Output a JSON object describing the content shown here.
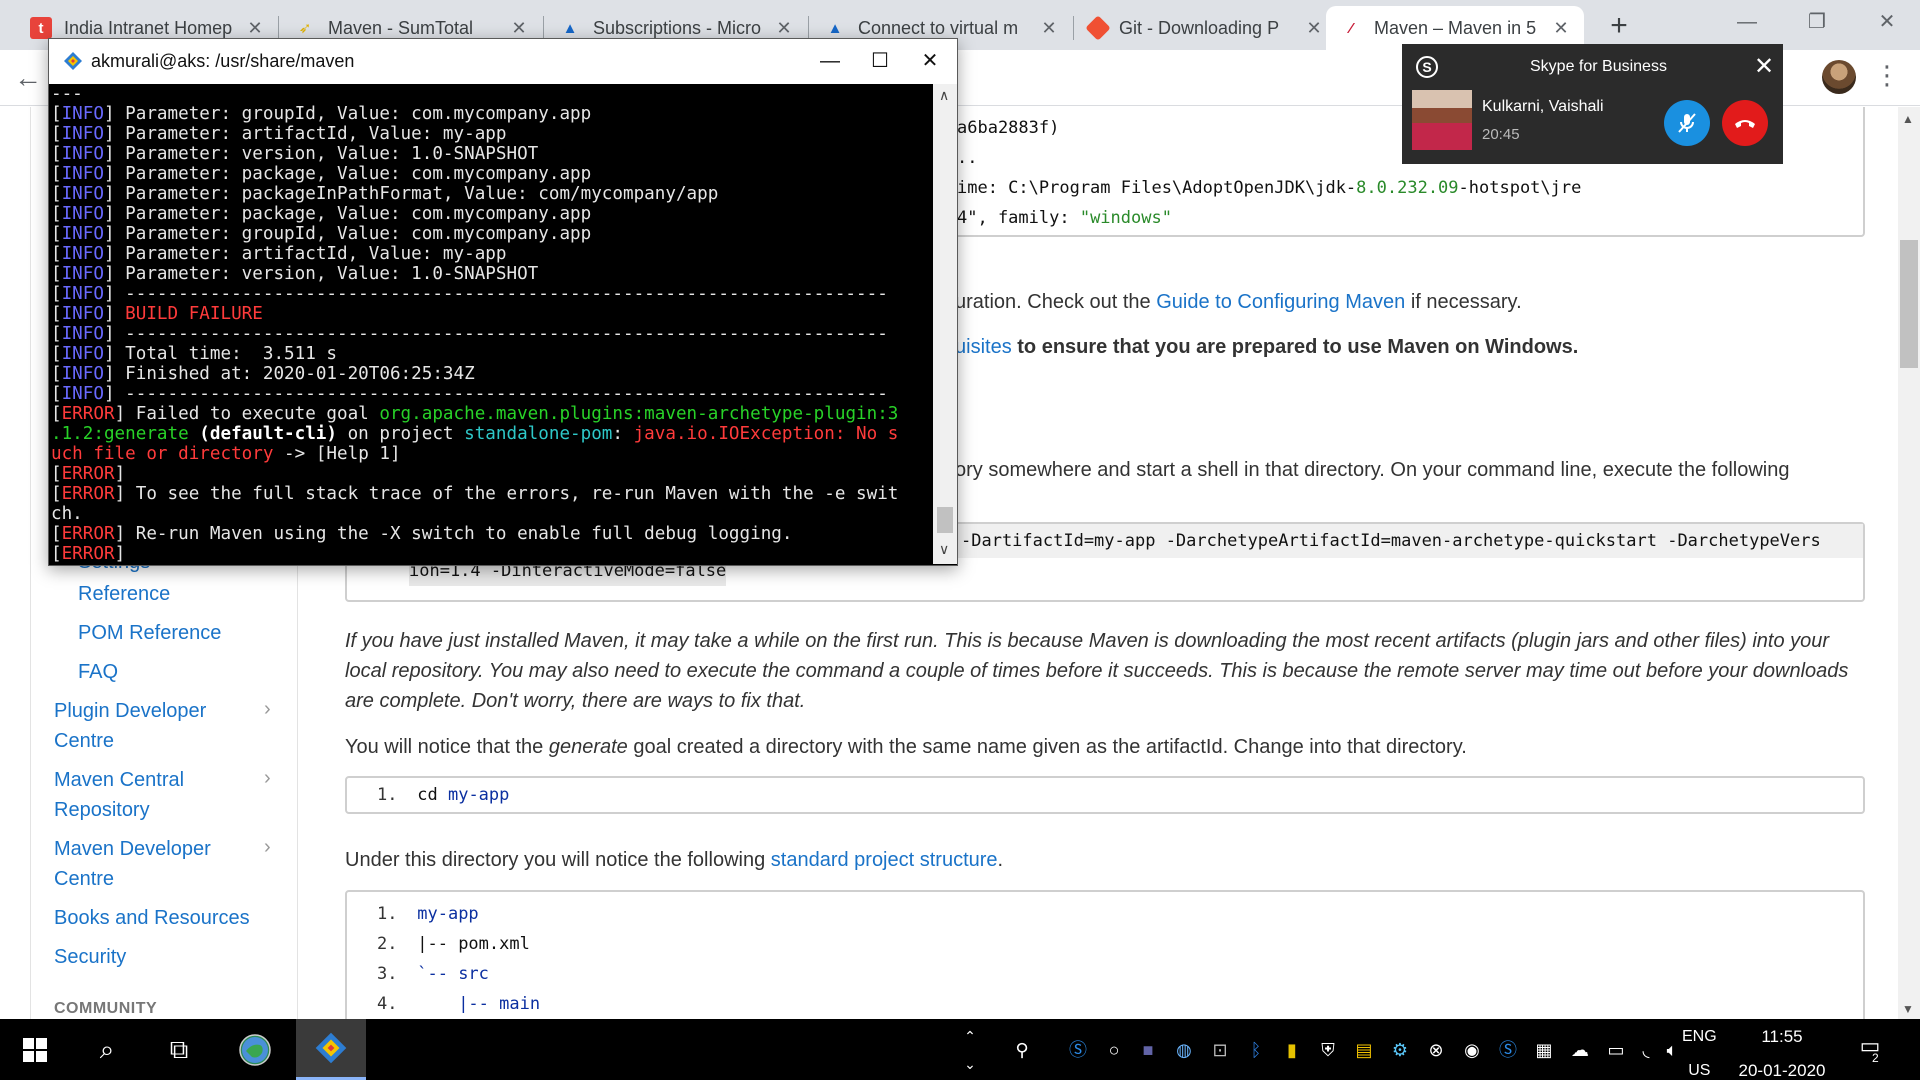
{
  "browser": {
    "tabs": [
      {
        "label": "India Intranet Homep",
        "icon": "t"
      },
      {
        "label": "Maven - SumTotal",
        "icon": "sumtotal-icon"
      },
      {
        "label": "Subscriptions - Micro",
        "icon": "azure-icon"
      },
      {
        "label": "Connect to virtual m",
        "icon": "azure-icon"
      },
      {
        "label": "Git - Downloading P",
        "icon": "git-icon"
      },
      {
        "label": "Maven – Maven in 5",
        "icon": "maven-feather-icon"
      }
    ],
    "new_tab": "+"
  },
  "terminal": {
    "title": "akmurali@aks: /usr/share/maven",
    "lines": [
      [
        {
          "t": "---",
          "c": ""
        }
      ],
      [
        {
          "t": "[",
          "c": ""
        },
        {
          "t": "INFO",
          "c": "t-info"
        },
        {
          "t": "] Parameter: groupId, Value: com.mycompany.app",
          "c": ""
        }
      ],
      [
        {
          "t": "[",
          "c": ""
        },
        {
          "t": "INFO",
          "c": "t-info"
        },
        {
          "t": "] Parameter: artifactId, Value: my-app",
          "c": ""
        }
      ],
      [
        {
          "t": "[",
          "c": ""
        },
        {
          "t": "INFO",
          "c": "t-info"
        },
        {
          "t": "] Parameter: version, Value: 1.0-SNAPSHOT",
          "c": ""
        }
      ],
      [
        {
          "t": "[",
          "c": ""
        },
        {
          "t": "INFO",
          "c": "t-info"
        },
        {
          "t": "] Parameter: package, Value: com.mycompany.app",
          "c": ""
        }
      ],
      [
        {
          "t": "[",
          "c": ""
        },
        {
          "t": "INFO",
          "c": "t-info"
        },
        {
          "t": "] Parameter: packageInPathFormat, Value: com/mycompany/app",
          "c": ""
        }
      ],
      [
        {
          "t": "[",
          "c": ""
        },
        {
          "t": "INFO",
          "c": "t-info"
        },
        {
          "t": "] Parameter: package, Value: com.mycompany.app",
          "c": ""
        }
      ],
      [
        {
          "t": "[",
          "c": ""
        },
        {
          "t": "INFO",
          "c": "t-info"
        },
        {
          "t": "] Parameter: groupId, Value: com.mycompany.app",
          "c": ""
        }
      ],
      [
        {
          "t": "[",
          "c": ""
        },
        {
          "t": "INFO",
          "c": "t-info"
        },
        {
          "t": "] Parameter: artifactId, Value: my-app",
          "c": ""
        }
      ],
      [
        {
          "t": "[",
          "c": ""
        },
        {
          "t": "INFO",
          "c": "t-info"
        },
        {
          "t": "] Parameter: version, Value: 1.0-SNAPSHOT",
          "c": ""
        }
      ],
      [
        {
          "t": "[",
          "c": ""
        },
        {
          "t": "INFO",
          "c": "t-info"
        },
        {
          "t": "] ------------------------------------------------------------------------",
          "c": ""
        }
      ],
      [
        {
          "t": "[",
          "c": ""
        },
        {
          "t": "INFO",
          "c": "t-info"
        },
        {
          "t": "] ",
          "c": ""
        },
        {
          "t": "BUILD FAILURE",
          "c": "t-red"
        }
      ],
      [
        {
          "t": "[",
          "c": ""
        },
        {
          "t": "INFO",
          "c": "t-info"
        },
        {
          "t": "] ------------------------------------------------------------------------",
          "c": ""
        }
      ],
      [
        {
          "t": "[",
          "c": ""
        },
        {
          "t": "INFO",
          "c": "t-info"
        },
        {
          "t": "] Total time:  3.511 s",
          "c": ""
        }
      ],
      [
        {
          "t": "[",
          "c": ""
        },
        {
          "t": "INFO",
          "c": "t-info"
        },
        {
          "t": "] Finished at: 2020-01-20T06:25:34Z",
          "c": ""
        }
      ],
      [
        {
          "t": "[",
          "c": ""
        },
        {
          "t": "INFO",
          "c": "t-info"
        },
        {
          "t": "] ------------------------------------------------------------------------",
          "c": ""
        }
      ],
      [
        {
          "t": "[",
          "c": ""
        },
        {
          "t": "ERROR",
          "c": "t-err"
        },
        {
          "t": "] Failed to execute goal ",
          "c": ""
        },
        {
          "t": "org.apache.maven.plugins:maven-archetype-plugin:3",
          "c": "t-green"
        }
      ],
      [
        {
          "t": ".1.2:generate",
          "c": "t-green"
        },
        {
          "t": " (default-cli)",
          "c": "t-white-b"
        },
        {
          "t": " on project ",
          "c": ""
        },
        {
          "t": "standalone-pom",
          "c": "t-cyan"
        },
        {
          "t": ": ",
          "c": ""
        },
        {
          "t": "java.io.IOException: No s",
          "c": "t-red"
        }
      ],
      [
        {
          "t": "uch file or directory",
          "c": "t-red"
        },
        {
          "t": " -> [Help 1]",
          "c": ""
        }
      ],
      [
        {
          "t": "[",
          "c": ""
        },
        {
          "t": "ERROR",
          "c": "t-err"
        },
        {
          "t": "]",
          "c": ""
        }
      ],
      [
        {
          "t": "[",
          "c": ""
        },
        {
          "t": "ERROR",
          "c": "t-err"
        },
        {
          "t": "] To see the full stack trace of the errors, re-run Maven with the -e swit",
          "c": ""
        }
      ],
      [
        {
          "t": "ch.",
          "c": ""
        }
      ],
      [
        {
          "t": "[",
          "c": ""
        },
        {
          "t": "ERROR",
          "c": "t-err"
        },
        {
          "t": "] Re-run Maven using the -X switch to enable full debug logging.",
          "c": ""
        }
      ],
      [
        {
          "t": "[",
          "c": ""
        },
        {
          "t": "ERROR",
          "c": "t-err"
        },
        {
          "t": "]",
          "c": ""
        }
      ]
    ]
  },
  "skype": {
    "title": "Skype for Business",
    "contact_name": "Kulkarni, Vaishali",
    "call_time": "20:45"
  },
  "sidebar": {
    "items": [
      {
        "label": "Settings",
        "partial": true
      },
      {
        "label": "Reference",
        "sub": true
      },
      {
        "label": "POM Reference",
        "sub": true
      },
      {
        "label": "FAQ",
        "sub": true
      },
      {
        "label": "Plugin Developer Centre",
        "line1": "Plugin Developer",
        "line2": "Centre",
        "expandable": true
      },
      {
        "label": "Maven Central Repository",
        "line1": "Maven Central",
        "line2": "Repository",
        "expandable": true
      },
      {
        "label": "Maven Developer Centre",
        "line1": "Maven Developer",
        "line2": "Centre",
        "expandable": true
      },
      {
        "label": "Books and Resources"
      },
      {
        "label": "Security"
      }
    ],
    "community_heading": "COMMUNITY"
  },
  "content": {
    "top_code": {
      "line1": "a6ba2883f)",
      "line2": "..",
      "line3_pre": "ime: C:\\Program Files\\AdoptOpenJDK\\jdk-",
      "line3_num": "8.0.232.09",
      "line3_post": "-hotspot\\jre",
      "line4_pre": "4\", family: ",
      "line4_str": "\"windows\""
    },
    "para_config": {
      "pre": "uration. Check out the ",
      "link": "Guide to Configuring Maven",
      "post": " if necessary."
    },
    "para_prereq": {
      "link": "uisites",
      "post": " to ensure that you are prepared to use Maven on Windows."
    },
    "para_shell": "ory somewhere and start a shell in that directory. On your command line, execute the following",
    "cmd_line1": "-DartifactId=my-app -DarchetypeArtifactId=maven-archetype-quickstart -DarchetypeVers",
    "cmd_line2": "ion=1.4 -DinteractiveMode=false",
    "para_first_run": "If you have just installed Maven, it may take a while on the first run. This is because Maven is downloading the most recent artifacts (plugin jars and other files) into your local repository. You may also need to execute the command a couple of times before it succeeds. This is because the remote server may time out before your downloads are complete. Don't worry, there are ways to fix that.",
    "para_generate": {
      "pre": "You will notice that the ",
      "em": "generate",
      "post": " goal created a directory with the same name given as the artifactId. Change into that directory."
    },
    "cd_code": {
      "num": "1.",
      "cmd": "cd ",
      "arg": "my-app"
    },
    "para_structure": {
      "pre": "Under this directory you will notice the following ",
      "link": "standard project structure",
      "post": "."
    },
    "tree": [
      {
        "num": "1.",
        "text": "my-app"
      },
      {
        "num": "2.",
        "text": "|-- pom.xml"
      },
      {
        "num": "3.",
        "text": "`-- src"
      },
      {
        "num": "4.",
        "text": "    |-- main"
      }
    ]
  },
  "taskbar": {
    "language": "ENG",
    "region": "US",
    "time": "11:55",
    "date": "20-01-2020",
    "notification_count": "2"
  }
}
